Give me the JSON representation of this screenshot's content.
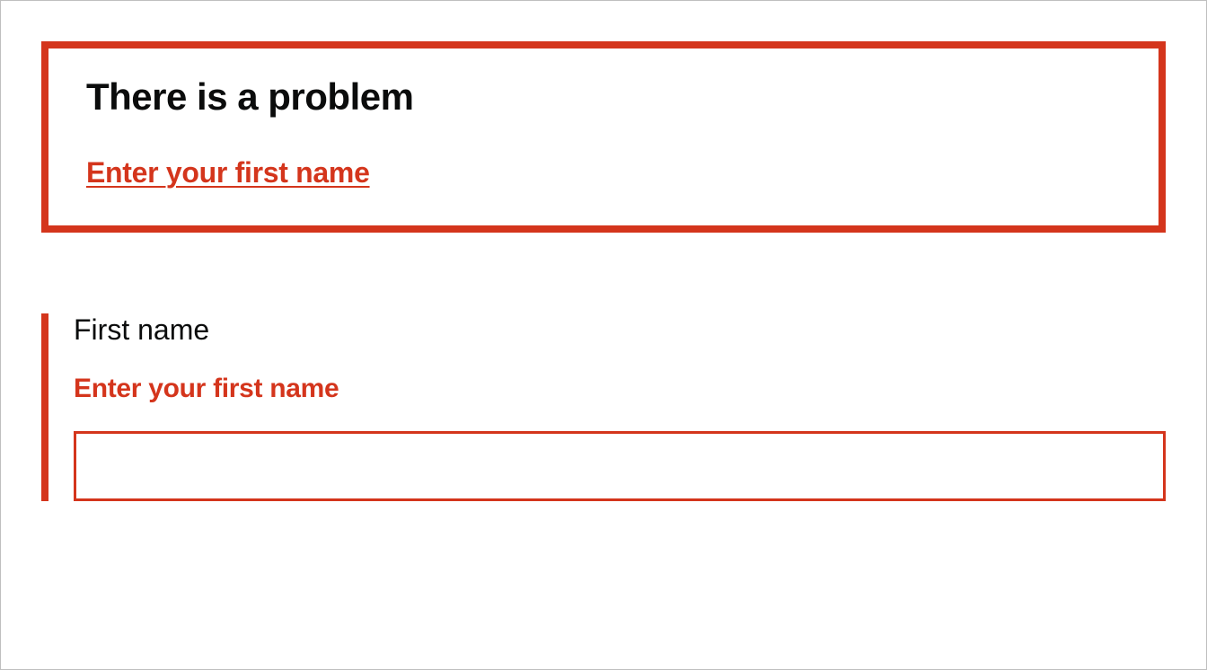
{
  "errorSummary": {
    "title": "There is a problem",
    "items": [
      {
        "label": "Enter your first name"
      }
    ]
  },
  "form": {
    "firstName": {
      "label": "First name",
      "error": "Enter your first name",
      "value": ""
    }
  }
}
